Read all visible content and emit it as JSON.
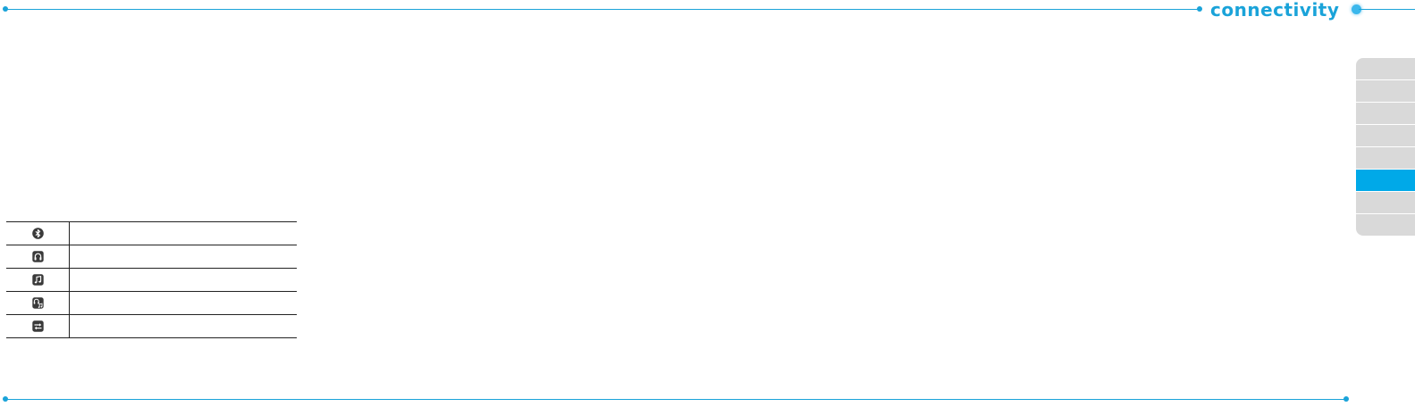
{
  "header": {
    "section_title": "connectivity"
  },
  "side_tabs": {
    "count": 8,
    "active_index": 5,
    "active_color": "#00a9e8",
    "inactive_color": "#d9d9d9"
  },
  "icon_table": {
    "rows": [
      {
        "icon": "bluetooth-icon",
        "description": ""
      },
      {
        "icon": "headset-icon",
        "description": ""
      },
      {
        "icon": "music-note-icon",
        "description": ""
      },
      {
        "icon": "headset-music-icon",
        "description": ""
      },
      {
        "icon": "transfer-arrows-icon",
        "description": ""
      }
    ]
  },
  "colors": {
    "accent": "#1aa3d9",
    "icon_fill": "#3a3a3a"
  }
}
